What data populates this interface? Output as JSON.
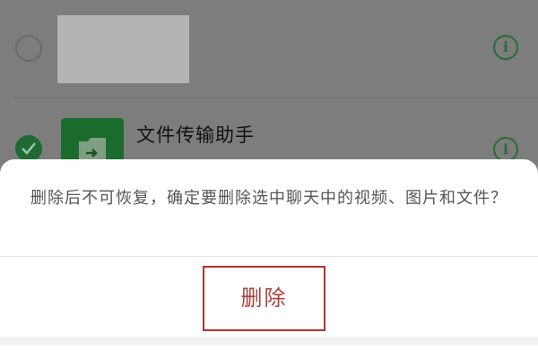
{
  "chat_list": {
    "items": [
      {
        "name": "",
        "selected": false
      },
      {
        "name": "文件传输助手",
        "selected": true
      }
    ],
    "info_icon_glyph": "i"
  },
  "dialog": {
    "message": "删除后不可恢复，确定要删除选中聊天中的视频、图片和文件？",
    "delete_label": "删除"
  },
  "colors": {
    "accent_green": "#1b6b2c",
    "destructive_red": "#a8423a",
    "overlay": "#7d7d7d"
  }
}
